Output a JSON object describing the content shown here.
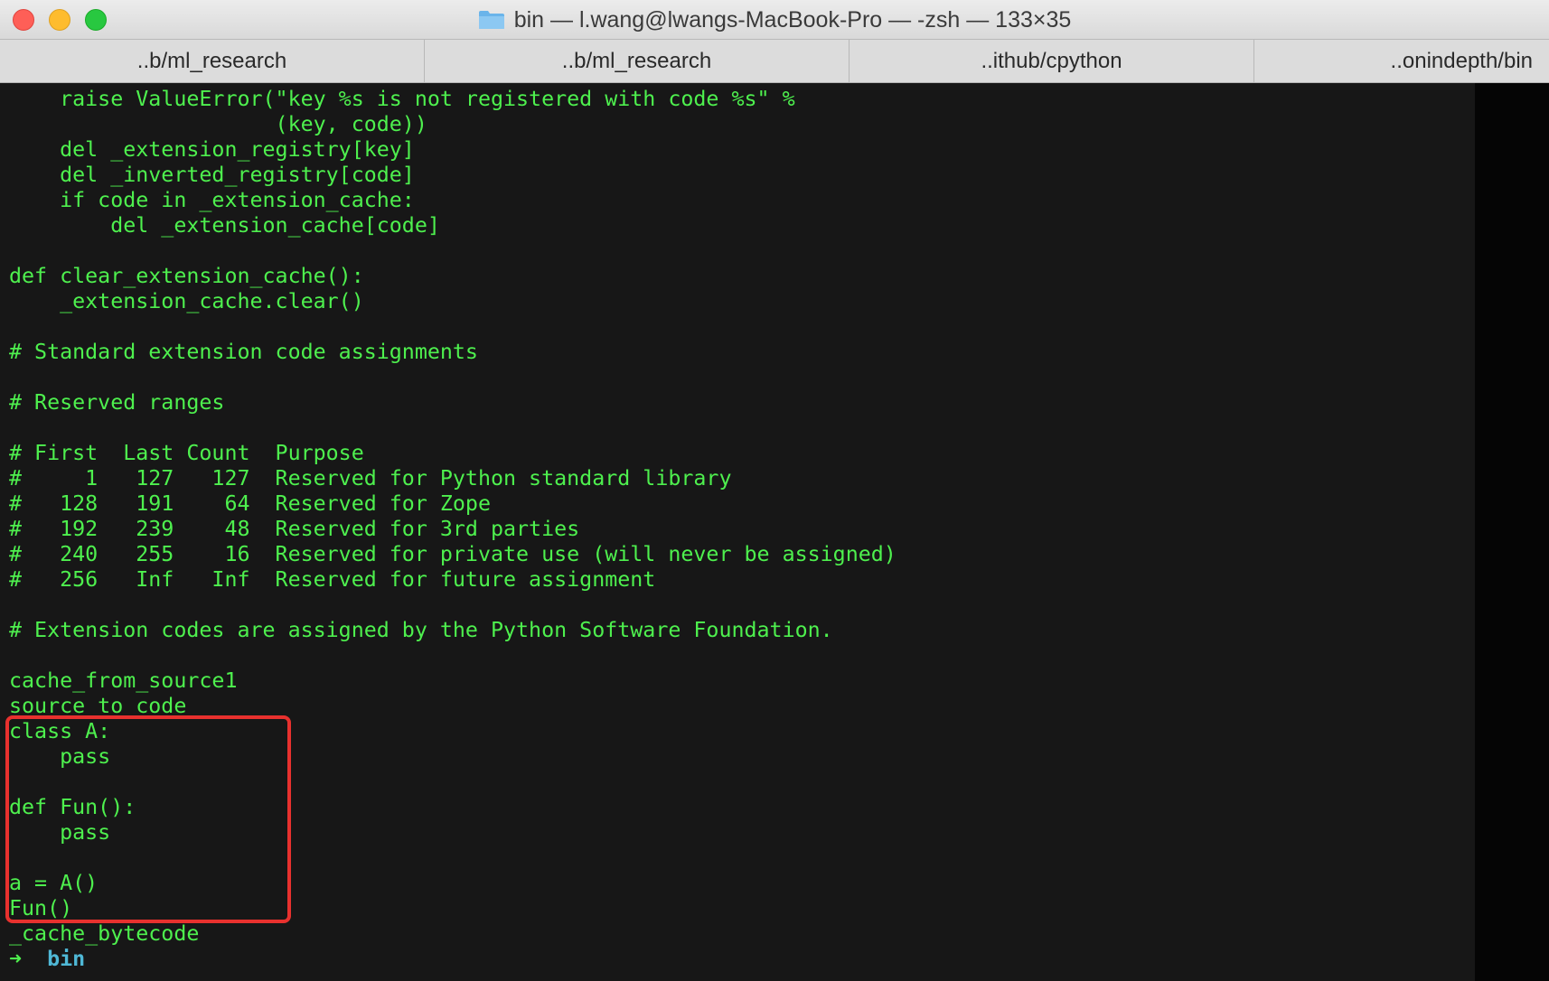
{
  "window": {
    "title": "bin — l.wang@lwangs-MacBook-Pro — -zsh — 133×35"
  },
  "tabs": [
    {
      "label": "..b/ml_research"
    },
    {
      "label": "..b/ml_research"
    },
    {
      "label": "..ithub/cpython"
    },
    {
      "label": "..onindepth/bin"
    }
  ],
  "terminal": {
    "lines": [
      "    raise ValueError(\"key %s is not registered with code %s\" %",
      "                     (key, code))",
      "    del _extension_registry[key]",
      "    del _inverted_registry[code]",
      "    if code in _extension_cache:",
      "        del _extension_cache[code]",
      "",
      "def clear_extension_cache():",
      "    _extension_cache.clear()",
      "",
      "# Standard extension code assignments",
      "",
      "# Reserved ranges",
      "",
      "# First  Last Count  Purpose",
      "#     1   127   127  Reserved for Python standard library",
      "#   128   191    64  Reserved for Zope",
      "#   192   239    48  Reserved for 3rd parties",
      "#   240   255    16  Reserved for private use (will never be assigned)",
      "#   256   Inf   Inf  Reserved for future assignment",
      "",
      "# Extension codes are assigned by the Python Software Foundation.",
      "",
      "cache_from_source1",
      "source_to_code",
      "class A:",
      "    pass",
      "",
      "def Fun():",
      "    pass",
      "",
      "a = A()",
      "Fun()",
      "_cache_bytecode"
    ],
    "prompt": {
      "arrow": "➜",
      "directory": "bin"
    }
  },
  "colors": {
    "terminal_text": "#4ef04e",
    "prompt_dir": "#4fb8d6",
    "highlight_box": "#e8312e",
    "background": "#171717"
  }
}
